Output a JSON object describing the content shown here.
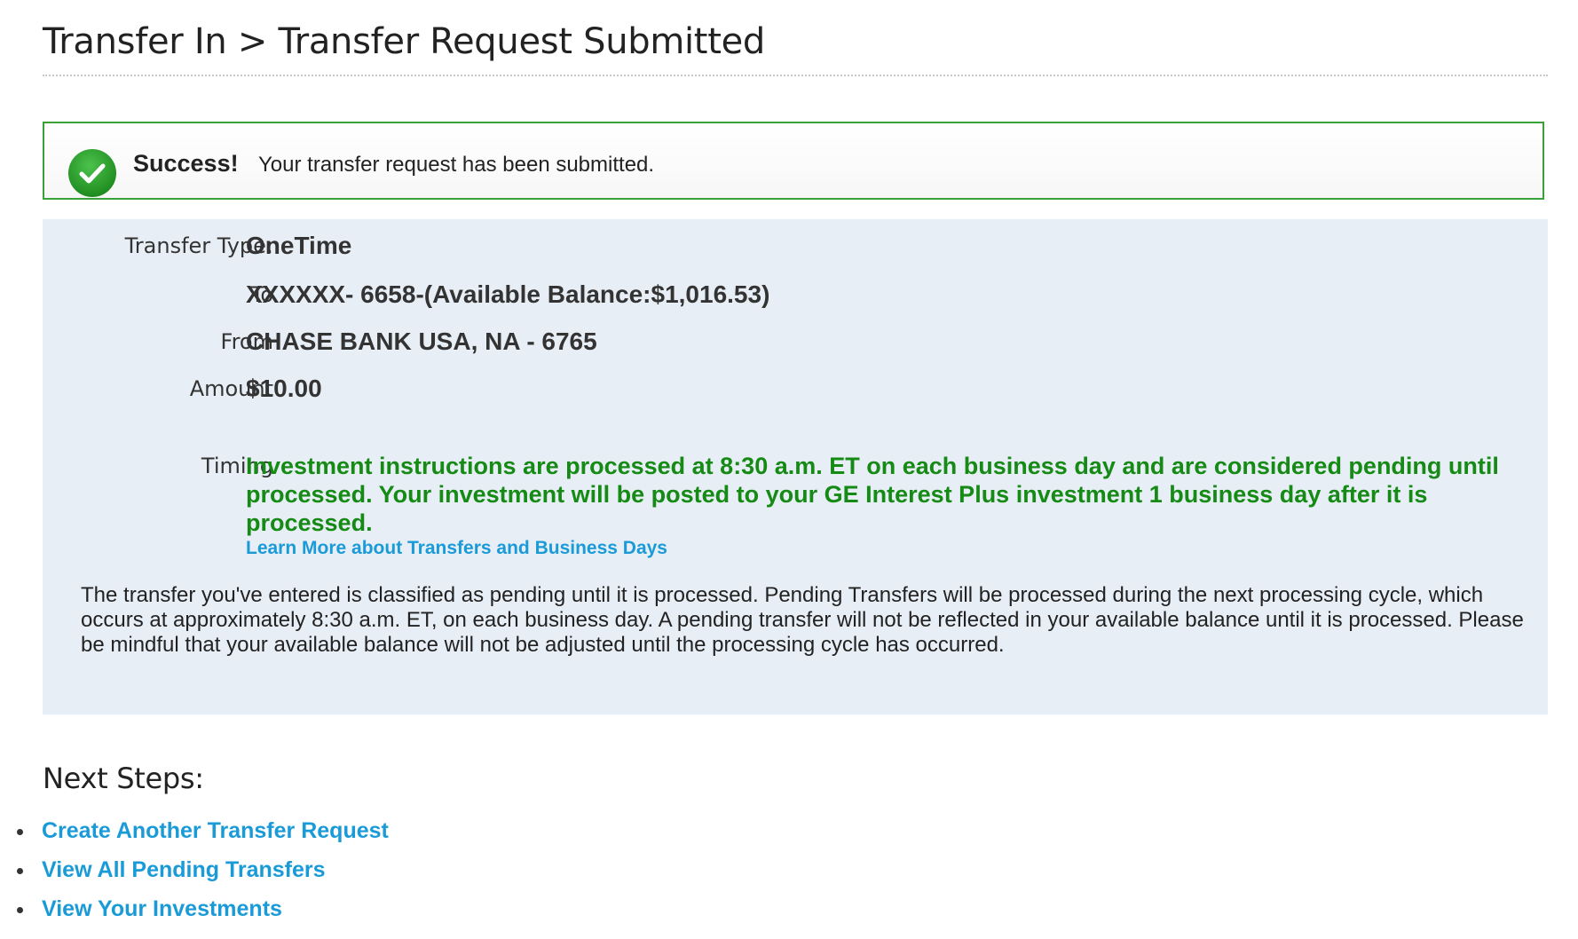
{
  "header": {
    "title": "Transfer In > Transfer Request Submitted"
  },
  "success": {
    "strong": "Success!",
    "message": "Your transfer request has been submitted.",
    "icon": "check-circle-icon",
    "border_color": "#3aa03a"
  },
  "details": {
    "transfer_type": {
      "label": "Transfer Type:",
      "value": "OneTime"
    },
    "to": {
      "label": "To",
      "value": "XXXXXX- 6658-(Available Balance:$1,016.53)"
    },
    "from": {
      "label": "From",
      "value": "CHASE BANK USA, NA - 6765"
    },
    "amount": {
      "label": "Amount",
      "value": "$10.00"
    },
    "timing": {
      "label": "Timing",
      "value": "Investment instructions are processed at 8:30 a.m. ET on each business day and are considered pending until processed. Your investment will be posted to your GE Interest Plus investment 1 business day after it is processed.",
      "link": "Learn More about Transfers and Business Days"
    },
    "note": "The transfer you've entered is classified as pending until it is processed. Pending Transfers will be processed during the next processing cycle, which occurs at approximately 8:30 a.m. ET, on each business day. A pending transfer will not be reflected in your available balance until it is processed. Please be mindful that your available balance will not be adjusted until the processing cycle has occurred.",
    "panel_color": "#e8eef5",
    "timing_color": "#158a15"
  },
  "next_steps": {
    "heading": "Next Steps:",
    "links": [
      "Create Another Transfer Request",
      "View All Pending Transfers",
      "View Your Investments"
    ],
    "link_color": "#1a9bd7"
  }
}
